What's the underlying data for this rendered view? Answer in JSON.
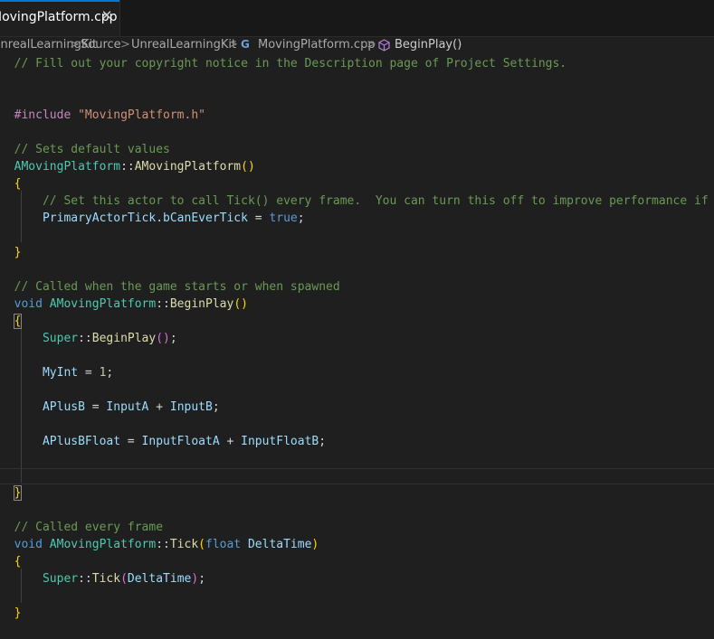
{
  "tab": {
    "title": "MovingPlatform.cpp",
    "close_glyph": "✕"
  },
  "breadcrumb": {
    "items": [
      "UnrealLearningKit",
      "Source",
      "UnrealLearningKit",
      "MovingPlatform.cpp",
      "BeginPlay()"
    ],
    "separator": ">",
    "file_icon": "G",
    "method_icon": "cube-icon"
  },
  "code": {
    "copyright": "// Fill out your copyright notice in the Description page of Project Settings.",
    "include_kw": "#include",
    "include_file": "\"MovingPlatform.h\"",
    "comment_defaults": "// Sets default values",
    "ctor_class": "AMovingPlatform",
    "ctor_name": "AMovingPlatform",
    "ctor_comment": "// Set this actor to call Tick() every frame.  You can turn this off to improve performance if you don't need it.",
    "tick_obj": "PrimaryActorTick",
    "tick_member": "bCanEverTick",
    "true_kw": "true",
    "comment_begin": "// Called when the game starts or when spawned",
    "void_kw": "void",
    "class_name": "AMovingPlatform",
    "beginplay_name": "BeginPlay",
    "super_kw": "Super",
    "myint_var": "MyInt",
    "myint_val": "1",
    "aplusb_var": "APlusB",
    "inputa_var": "InputA",
    "inputb_var": "InputB",
    "aplusbfloat_var": "APlusBFloat",
    "inputfloata_var": "InputFloatA",
    "inputfloatb_var": "InputFloatB",
    "comment_tick": "// Called every frame",
    "tick_name": "Tick",
    "float_kw": "float",
    "deltatime_param": "DeltaTime"
  }
}
